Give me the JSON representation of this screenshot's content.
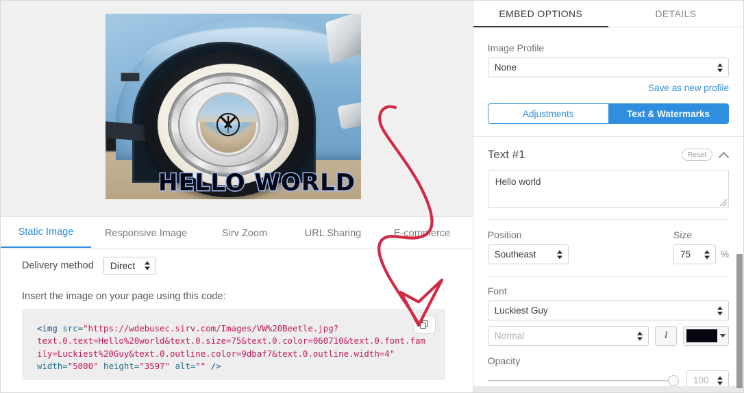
{
  "preview": {
    "watermark_text": "HELLO WORLD",
    "alt": "VW Beetle wheel photo"
  },
  "left_tabs": [
    {
      "label": "Static Image",
      "active": true
    },
    {
      "label": "Responsive Image",
      "active": false
    },
    {
      "label": "Sirv Zoom",
      "active": false
    },
    {
      "label": "URL Sharing",
      "active": false
    },
    {
      "label": "E-commerce",
      "active": false
    }
  ],
  "delivery": {
    "label": "Delivery method",
    "value": "Direct"
  },
  "code_section": {
    "instruction": "Insert the image on your page using this code:",
    "copy_button_title": "Copy",
    "lines": [
      "<img src=\"https://wdebusec.sirv.com/Images/VW%20Beetle.jpg?",
      "text.0.text=Hello%20world&text.0.size=75&text.0.color=060710&text.0.font.fam",
      "ily=Luckiest%20Guy&text.0.outline.color=9dbaf7&text.0.outline.width=4\"",
      "width=\"5000\" height=\"3597\" alt=\"\" />"
    ],
    "tag": "<img",
    "attr_src": "src=",
    "src_value": "\"https://wdebusec.sirv.com/Images/VW%20Beetle.jpg?",
    "query_line2": "text.0.text=Hello%20world&text.0.size=75&text.0.color=060710&text.0.font.fam",
    "query_line3": "ily=Luckiest%20Guy&text.0.outline.color=9dbaf7&text.0.outline.width=4\"",
    "attr_width": "width=",
    "val_width": "\"5000\"",
    "attr_height": "height=",
    "val_height": "\"3597\"",
    "attr_alt": "alt=",
    "val_alt": "\"\"",
    "close_tag": "/>"
  },
  "right_tabs": [
    {
      "label": "EMBED OPTIONS",
      "active": true
    },
    {
      "label": "DETAILS",
      "active": false
    }
  ],
  "image_profile": {
    "label": "Image Profile",
    "value": "None",
    "save_link": "Save as new profile"
  },
  "segmented": {
    "adjustments": "Adjustments",
    "text_watermarks": "Text & Watermarks"
  },
  "text_block": {
    "title": "Text #1",
    "reset": "Reset",
    "content": "Hello world",
    "position_label": "Position",
    "position_value": "Southeast",
    "size_label": "Size",
    "size_value": "75",
    "size_unit": "%"
  },
  "font_block": {
    "label": "Font",
    "family_value": "Luckiest Guy",
    "weight_placeholder": "Normal",
    "italic_glyph": "I",
    "color_hex": "#060710"
  },
  "opacity_block": {
    "label": "Opacity",
    "value": "100"
  },
  "colors": {
    "accent_blue": "#2f8ee0",
    "annotation_red": "#d32a44",
    "outline_blue": "#9dbaf7",
    "text_color": "#060710"
  }
}
